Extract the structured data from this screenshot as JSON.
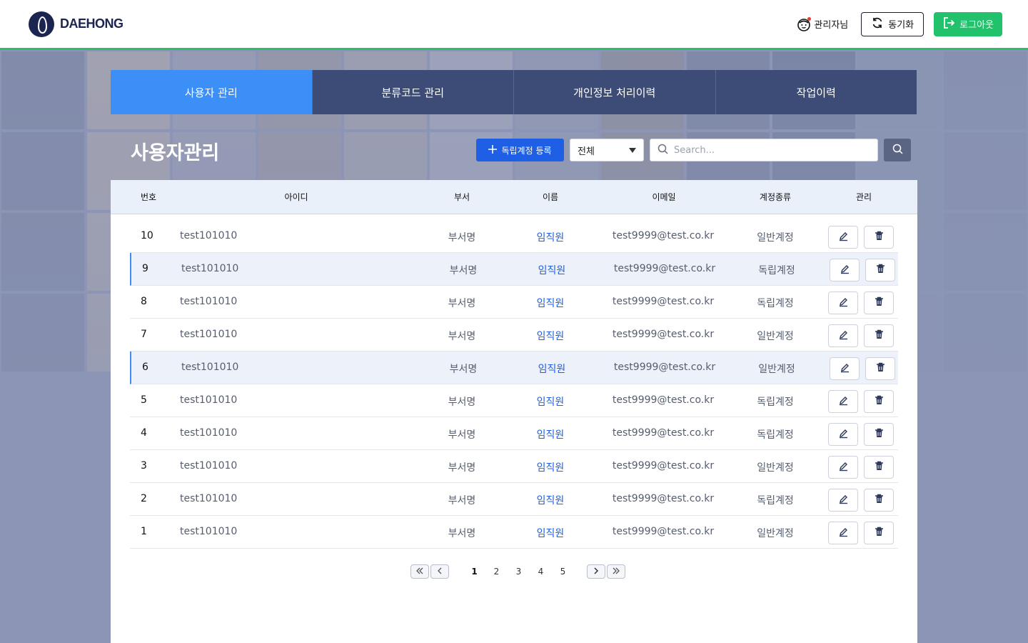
{
  "brand": {
    "logo_text": "DAEHONG"
  },
  "header": {
    "user_label": "관리자님",
    "sync_label": "동기화",
    "logout_label": "로그아웃",
    "accent_color": "#22c16b"
  },
  "tabs": [
    {
      "label": "사용자 관리",
      "active": true
    },
    {
      "label": "분류코드 관리",
      "active": false
    },
    {
      "label": "개인정보 처리이력",
      "active": false
    },
    {
      "label": "작업이력",
      "active": false
    }
  ],
  "page": {
    "title": "사용자관리",
    "register_label": "독립계정 등록",
    "filter_selected": "전체",
    "search_placeholder": "Search..."
  },
  "table": {
    "columns": [
      "번호",
      "아이디",
      "부서",
      "이름",
      "이메일",
      "계정종류",
      "관리"
    ],
    "rows": [
      {
        "no": "10",
        "id": "test101010",
        "dept": "부서명",
        "name": "임직원",
        "email": "test9999@test.co.kr",
        "type": "일반계정"
      },
      {
        "no": "9",
        "id": "test101010",
        "dept": "부서명",
        "name": "임직원",
        "email": "test9999@test.co.kr",
        "type": "독립계정"
      },
      {
        "no": "8",
        "id": "test101010",
        "dept": "부서명",
        "name": "임직원",
        "email": "test9999@test.co.kr",
        "type": "독립계정"
      },
      {
        "no": "7",
        "id": "test101010",
        "dept": "부서명",
        "name": "임직원",
        "email": "test9999@test.co.kr",
        "type": "일반계정"
      },
      {
        "no": "6",
        "id": "test101010",
        "dept": "부서명",
        "name": "임직원",
        "email": "test9999@test.co.kr",
        "type": "일반계정"
      },
      {
        "no": "5",
        "id": "test101010",
        "dept": "부서명",
        "name": "임직원",
        "email": "test9999@test.co.kr",
        "type": "독립계정"
      },
      {
        "no": "4",
        "id": "test101010",
        "dept": "부서명",
        "name": "임직원",
        "email": "test9999@test.co.kr",
        "type": "독립계정"
      },
      {
        "no": "3",
        "id": "test101010",
        "dept": "부서명",
        "name": "임직원",
        "email": "test9999@test.co.kr",
        "type": "일반계정"
      },
      {
        "no": "2",
        "id": "test101010",
        "dept": "부서명",
        "name": "임직원",
        "email": "test9999@test.co.kr",
        "type": "독립계정"
      },
      {
        "no": "1",
        "id": "test101010",
        "dept": "부서명",
        "name": "임직원",
        "email": "test9999@test.co.kr",
        "type": "일반계정"
      }
    ],
    "highlighted_rows": [
      "9",
      "6"
    ]
  },
  "pagination": {
    "pages": [
      "1",
      "2",
      "3",
      "4",
      "5"
    ],
    "current": "1"
  }
}
